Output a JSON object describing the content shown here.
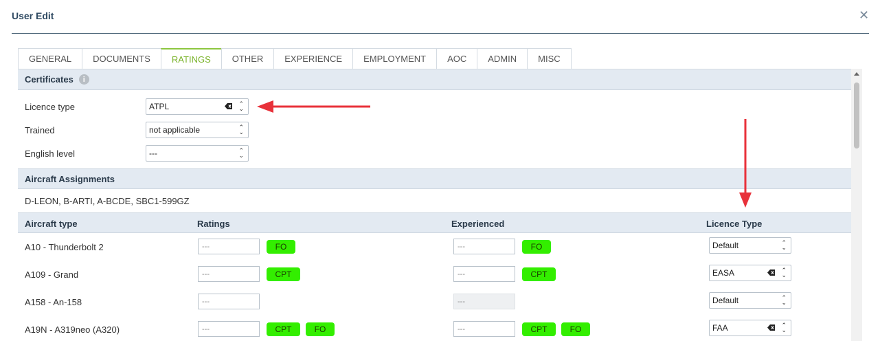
{
  "dialog": {
    "title": "User Edit",
    "close_glyph": "✕"
  },
  "tabs": [
    {
      "label": "GENERAL"
    },
    {
      "label": "DOCUMENTS"
    },
    {
      "label": "RATINGS",
      "active": true
    },
    {
      "label": "OTHER"
    },
    {
      "label": "EXPERIENCE"
    },
    {
      "label": "EMPLOYMENT"
    },
    {
      "label": "AOC"
    },
    {
      "label": "ADMIN"
    },
    {
      "label": "MISC"
    }
  ],
  "certificates": {
    "header": "Certificates",
    "info_icon": "i",
    "licence_type": {
      "label": "Licence type",
      "value": "ATPL"
    },
    "trained": {
      "label": "Trained",
      "value": "not applicable"
    },
    "english_level": {
      "label": "English level",
      "value": "---"
    }
  },
  "assignments": {
    "header": "Aircraft Assignments",
    "list": "D-LEON, B-ARTI, A-BCDE, SBC1-599GZ"
  },
  "table": {
    "headers": {
      "aircraft": "Aircraft type",
      "ratings": "Ratings",
      "experienced": "Experienced",
      "licence": "Licence Type"
    },
    "rows": [
      {
        "aircraft": "A10 - Thunderbolt 2",
        "ratings_input": "---",
        "ratings_badges": [
          "FO"
        ],
        "exp_input": "---",
        "exp_badges": [
          "FO"
        ],
        "licence": "Default",
        "clearable": false
      },
      {
        "aircraft": "A109 - Grand",
        "ratings_input": "---",
        "ratings_badges": [
          "CPT"
        ],
        "exp_input": "---",
        "exp_badges": [
          "CPT"
        ],
        "licence": "EASA",
        "clearable": true
      },
      {
        "aircraft": "A158 - An-158",
        "ratings_input": "---",
        "ratings_badges": [],
        "exp_input": "---",
        "exp_badges": [],
        "exp_disabled": true,
        "licence": "Default",
        "clearable": false
      },
      {
        "aircraft": "A19N - A319neo (A320)",
        "ratings_input": "---",
        "ratings_badges": [
          "CPT",
          "FO"
        ],
        "exp_input": "---",
        "exp_badges": [
          "CPT",
          "FO"
        ],
        "licence": "FAA",
        "clearable": true
      }
    ]
  },
  "colors": {
    "accent": "#8cc63f",
    "badge": "#33ee00",
    "arrow": "#e8313a",
    "header_bg": "#e3eaf2"
  }
}
